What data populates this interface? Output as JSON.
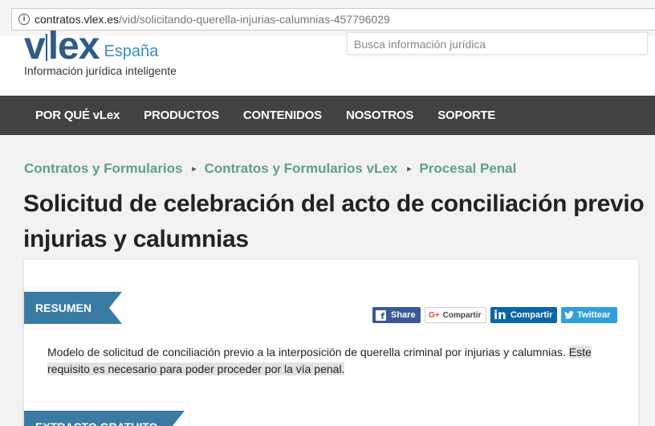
{
  "browser": {
    "url_domain": "contratos.vlex.es",
    "url_path": "/vid/solicitando-querella-injurias-calumnias-457796029"
  },
  "header": {
    "logo_v": "v",
    "logo_rest": "lex",
    "logo_country": "España",
    "tagline": "Información jurídica inteligente",
    "search_placeholder": "Busca información jurídica"
  },
  "nav": {
    "items": [
      {
        "label": "POR QUÉ vLex"
      },
      {
        "label": "PRODUCTOS"
      },
      {
        "label": "CONTENIDOS"
      },
      {
        "label": "NOSOTROS"
      },
      {
        "label": "SOPORTE"
      }
    ]
  },
  "breadcrumb": {
    "separator": "▸",
    "items": [
      {
        "label": "Contratos y Formularios"
      },
      {
        "label": "Contratos y Formularios vLex"
      },
      {
        "label": "Procesal Penal"
      }
    ]
  },
  "page": {
    "title_line1": "Solicitud de celebración del acto de conciliación previo",
    "title_line2": "injurias y calumnias"
  },
  "card": {
    "resumen_label": "RESUMEN",
    "extracto_label": "EXTRACTO GRATUITO",
    "share": {
      "facebook_label": "Share",
      "google_label": "Compartir",
      "linkedin_label": "Compartir",
      "twitter_label": "Twittear"
    },
    "summary_text": "Modelo de solicitud de conciliación previo a la interposición de querella criminal por injurias y calumnias. ",
    "summary_highlight_1": "Este",
    "summary_highlight_2": "requisito es necesario para poder proceder por la vía penal."
  },
  "colors": {
    "brand": "#2d5c85",
    "breadcrumb": "#5f9e8f",
    "nav_bg": "#424242",
    "ribbon": "#3a7ba3"
  }
}
